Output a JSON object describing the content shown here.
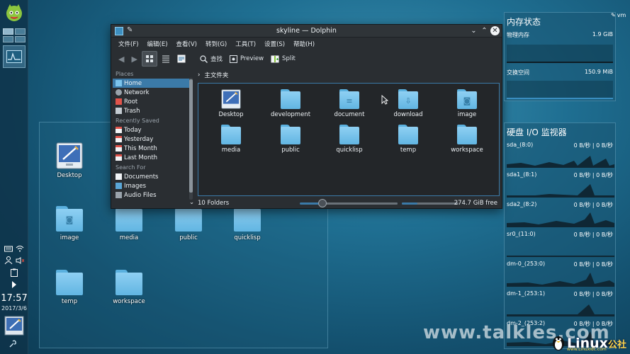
{
  "panel": {
    "clock_time": "17:57",
    "clock_date": "2017/3/6"
  },
  "desktop_icons": [
    {
      "label": "Desktop",
      "kind": "desktop"
    },
    {
      "label": "image",
      "kind": "folder",
      "emblem": "camera-icon"
    },
    {
      "label": "media",
      "kind": "folder"
    },
    {
      "label": "public",
      "kind": "folder"
    },
    {
      "label": "quicklisp",
      "kind": "folder"
    },
    {
      "label": "temp",
      "kind": "folder"
    },
    {
      "label": "workspace",
      "kind": "folder"
    }
  ],
  "dolphin": {
    "title": "skyline — Dolphin",
    "menu": [
      "文件(F)",
      "编辑(E)",
      "查看(V)",
      "转到(G)",
      "工具(T)",
      "设置(S)",
      "帮助(H)"
    ],
    "toolbar": {
      "find": "查找",
      "preview": "Preview",
      "split": "Split"
    },
    "places": {
      "sections": [
        {
          "title": "Places",
          "items": [
            {
              "label": "Home",
              "icon": "home-icon",
              "selected": true
            },
            {
              "label": "Network",
              "icon": "network-icon",
              "selected": false
            },
            {
              "label": "Root",
              "icon": "root-icon",
              "selected": false
            },
            {
              "label": "Trash",
              "icon": "trash-icon",
              "selected": false
            }
          ]
        },
        {
          "title": "Recently Saved",
          "items": [
            {
              "label": "Today",
              "icon": "calendar-icon",
              "selected": false
            },
            {
              "label": "Yesterday",
              "icon": "calendar-icon",
              "selected": false
            },
            {
              "label": "This Month",
              "icon": "calendar-icon",
              "selected": false
            },
            {
              "label": "Last Month",
              "icon": "calendar-icon",
              "selected": false
            }
          ]
        },
        {
          "title": "Search For",
          "items": [
            {
              "label": "Documents",
              "icon": "documents-icon",
              "selected": false
            },
            {
              "label": "Images",
              "icon": "images-icon",
              "selected": false
            },
            {
              "label": "Audio Files",
              "icon": "audio-icon",
              "selected": false
            }
          ]
        }
      ]
    },
    "breadcrumb": "主文件夹",
    "files": [
      {
        "label": "Desktop",
        "kind": "desktop"
      },
      {
        "label": "development",
        "kind": "folder"
      },
      {
        "label": "document",
        "kind": "folder",
        "emblem": "document"
      },
      {
        "label": "download",
        "kind": "folder",
        "emblem": "download"
      },
      {
        "label": "image",
        "kind": "folder",
        "emblem": "camera"
      },
      {
        "label": "media",
        "kind": "folder"
      },
      {
        "label": "public",
        "kind": "folder"
      },
      {
        "label": "quicklisp",
        "kind": "folder"
      },
      {
        "label": "temp",
        "kind": "folder"
      },
      {
        "label": "workspace",
        "kind": "folder"
      }
    ],
    "status": {
      "folders": "10 Folders",
      "free": "274.7 GiB free",
      "zoom_fraction": 0.23,
      "used_fraction": 0.28
    }
  },
  "memory_widget": {
    "title": "内存状态",
    "rows": [
      {
        "label": "物理内存",
        "value": "1.9 GiB"
      },
      {
        "label": "交换空间",
        "value": "150.9 MiB"
      }
    ]
  },
  "vm_label": "vm",
  "io_widget": {
    "title": "硬盘 I/O 监视器",
    "rows": [
      {
        "label": "sda_(8:0)",
        "value": "0 B/秒 | 0 B/秒"
      },
      {
        "label": "sda1_(8:1)",
        "value": "0 B/秒 | 0 B/秒"
      },
      {
        "label": "sda2_(8:2)",
        "value": "0 B/秒 | 0 B/秒"
      },
      {
        "label": "sr0_(11:0)",
        "value": "0 B/秒 | 0 B/秒"
      },
      {
        "label": "dm-0_(253:0)",
        "value": "0 B/秒 | 0 B/秒"
      },
      {
        "label": "dm-1_(253:1)",
        "value": "0 B/秒 | 0 B/秒"
      },
      {
        "label": "dm-2_(253:2)",
        "value": "0 B/秒 | 0 B/秒"
      }
    ]
  },
  "watermark": {
    "site": "www.talkles.com",
    "brand": "Linux",
    "brand_cn": "公社",
    "brand_url": "www.Linuxidc.com"
  },
  "colors": {
    "selection": "#3b7aa8",
    "folder": "#7cc4ec",
    "window_bg": "#2a2e32"
  }
}
